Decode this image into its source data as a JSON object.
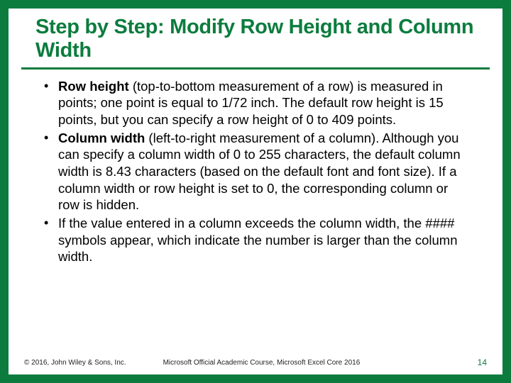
{
  "header": {
    "title": "Step by Step: Modify Row Height and Column Width"
  },
  "body": {
    "bullets": [
      {
        "lead": "Row height",
        "rest": " (top-to-bottom measurement of a row) is measured in points; one point is equal to 1/72 inch. The default row height is 15 points, but you can specify a row height of 0 to 409 points."
      },
      {
        "lead": "Column width",
        "rest": " (left-to-right measurement of a column). Although you can specify a column width of 0 to 255 characters, the default column width is 8.43 characters (based on the default font and font size). If a column width or row height is set to 0, the corresponding column or row is hidden."
      },
      {
        "lead": "",
        "rest": "If the value entered in a column exceeds the column width, the #### symbols appear, which indicate the number is larger than the column width."
      }
    ]
  },
  "footer": {
    "copyright": "© 2016, John Wiley & Sons, Inc.",
    "course": "Microsoft Official Academic Course, Microsoft Excel Core 2016",
    "page": "14"
  }
}
